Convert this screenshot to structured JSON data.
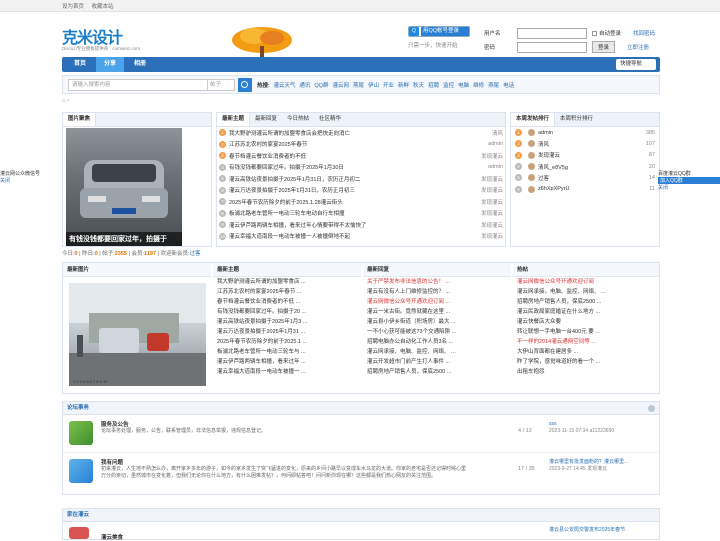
{
  "topbar": {
    "sethome": "设为首页",
    "favorite": "收藏本站"
  },
  "logo": {
    "main": "克米设计",
    "sub": "Discuz!专业模板提供商 · comsenz.com"
  },
  "tree_label": "成长小树",
  "qq": {
    "button": "用QQ帐号登录",
    "links": "只需一步，快速开始"
  },
  "login": {
    "user_label": "用户名",
    "pass_label": "密码",
    "auto": "自动登录",
    "forgot": "找回密码",
    "button": "登录",
    "register": "立即注册"
  },
  "nav": {
    "home": "首页",
    "share": "分享",
    "album": "相册",
    "quick": "快捷导航"
  },
  "search": {
    "placeholder": "请输入搜索内容",
    "scope": "帖子",
    "hot_label": "热搜:",
    "hot": [
      "灌云天气",
      "通讯",
      "QQ群",
      "灌云网",
      "燕尾",
      "伊山",
      "开业",
      "新鲜",
      "秋天",
      "招聘",
      "监控",
      "电脑",
      "维修",
      "燕尾",
      "电话"
    ]
  },
  "panel1": {
    "title": "图片聚焦",
    "caption": "有钱没钱都要回家过年，拍摄于"
  },
  "panel2": {
    "tabs": [
      "最新主题",
      "最新回复",
      "今日热帖",
      "社区精华"
    ],
    "rows": [
      {
        "n": "1",
        "t": "我大野驴测灌云所谓的加盟零食店会把快走向消亡",
        "a": "清风"
      },
      {
        "n": "2",
        "t": "江苏苏北农村的家宴2025年春节",
        "a": "admin"
      },
      {
        "n": "3",
        "t": "春节档灌云餐饮业消费者的不低",
        "a": "发现灌云"
      },
      {
        "n": "4",
        "t": "有钱没钱都要回家过年。拍摄于2025年1月30日",
        "a": "admin"
      },
      {
        "n": "5",
        "t": "灌云高铁站夜景拍摄于2025年1月31日，农历正月初二",
        "a": "发现灌云"
      },
      {
        "n": "6",
        "t": "灌云万达夜景拍摄于2025年1月31日，农历正月初三",
        "a": "发现灌云"
      },
      {
        "n": "7",
        "t": "2025年春节农历除夕的前于2025.1.28灌云街头",
        "a": "发现灌云"
      },
      {
        "n": "8",
        "t": "板浦北路老车管所一电动三轮车电动自行车相撞",
        "a": "发现灌云"
      },
      {
        "n": "9",
        "t": "灌云伊芦路两辆车相撞，看来过年心情要带得不太愉快了",
        "a": "发现灌云"
      },
      {
        "n": "10",
        "t": "灌云幸福大道南段一电动车被撞一人被撞倒地不起",
        "a": "发现灌云"
      }
    ]
  },
  "panel3": {
    "tabs": [
      "本周发帖排行",
      "本周积分排行"
    ],
    "rows": [
      {
        "n": "admin",
        "v": "385"
      },
      {
        "n": "清风",
        "v": "107"
      },
      {
        "n": "发现灌云",
        "v": "87"
      },
      {
        "n": "清风_e8V5g",
        "v": "20"
      },
      {
        "n": "过客",
        "v": "14"
      },
      {
        "n": "z6hXpXPyrU",
        "v": "11"
      }
    ]
  },
  "stats": {
    "today_l": "今日:",
    "today": "0",
    "yest_l": "昨日:",
    "yest": "0",
    "posts_l": "帖子:",
    "posts": "2355",
    "members_l": "会员:",
    "members": "1197",
    "welcome": "欢迎新会员:",
    "newuser": "过客"
  },
  "grid": {
    "c1": {
      "title": "最新图片",
      "pages": "1 2 3 4 5 6 7 8 9 10"
    },
    "c2": {
      "title": "最新主题",
      "items": [
        "我大野驴测灌云所谓的加盟零食店 ...",
        "江苏苏北农村的家宴2025年春节 ...",
        "春节档灌云餐饮业消费者的不低 ...",
        "有钱没钱都要回家过年。拍摄于20 ...",
        "灌云高铁站夜景拍摄于2025年1月3 ...",
        "灌云万达夜景拍摄于2025年1月31 ...",
        "2025年春节农历除夕的前于2025.1 ...",
        "板浦北路老车管所一电动三轮车与 ...",
        "灌云伊芦路两辆车相撞，看来过年 ...",
        "灌云幸福大道南段一电动车被撞一 ..."
      ]
    },
    "c3": {
      "title": "最新回复",
      "items": [
        "关于严禁发布非法信息的公告！ ...",
        "灌云有没有人上门维修监控的？ ...",
        "灌云网微信公众号开通欢迎订阅 ...",
        "灌云一米古街。竟然就藏在这里 ...",
        "灌云县小伊乡街道（积场房）最大 ...",
        "一不小心获可能被这73个交通陷阱 ...",
        "招聘电脑办公自动化工作人员3名 ...",
        "灌云网承接、电脑、监控、网络、 ...",
        "灌云开发超市门前产生打人事件 ...",
        "招聘房地产销售人员，保底2500 ..."
      ]
    },
    "c4": {
      "title": "热帖",
      "items": [
        "灌云网微信公众号开通欢迎订阅",
        "灌云网承接，电脑、监控、网络、 ...",
        "招聘房地产销售人员，保底2500 ...",
        "灌云民政局家庭婚证在什么地方 ...",
        "灌云快餐店大众要",
        "转让联想一手电脑一台400元 要 ...",
        "不一样的2014灌云通网空间等 ...",
        "大伊山背面都在建居多 ...",
        "昨了学院，感觉味道好的看一个 ...",
        "出租车抱怨"
      ]
    }
  },
  "section1": {
    "title": "论坛事务",
    "forums": [
      {
        "name": "服务及公告",
        "desc": "论坛事务处理，服务，公告，联系管理员，非法信息举报，违规信息登记。",
        "count": "4 / 12",
        "last": "sss",
        "date": "2023-11-15 07:34 a11223690"
      },
      {
        "name": "我有问题",
        "desc": "初来灌云，人生地不熟怎么办，离开家乡多年的游子，如今的家乡发生了突飞猛进的变化，原来的乡间小路早以变成车水马龙的大道。你家的老宅是否还记得时候心里万分的亲切，虽然城市在变化着，但我们无论你在什么地方，有什么困难发帖？，何问即帖答吧！问问新你现在哪？这些都是我们热心网友的关注范围。",
        "count": "17 / 35",
        "last": "灌云哪里有批发面粉的？灌云哪里…",
        "date": "2023-9-27 14:45 发现灌云"
      }
    ]
  },
  "section2": {
    "title": "家在灌云",
    "forum": "灌云美食",
    "last": "灌云县公安局交警发布2025年春节"
  },
  "side": {
    "left": "灌云网公众微信号",
    "left_close": "关闭",
    "right": "百度灌云QQ群",
    "right_btn": "加入QQ群",
    "right_close": "关闭"
  },
  "colors": {
    "nav": "#2b6fb9",
    "nav_active": "#4ba3ea",
    "accent": "#f39c44",
    "link": "#2a6fb5"
  }
}
